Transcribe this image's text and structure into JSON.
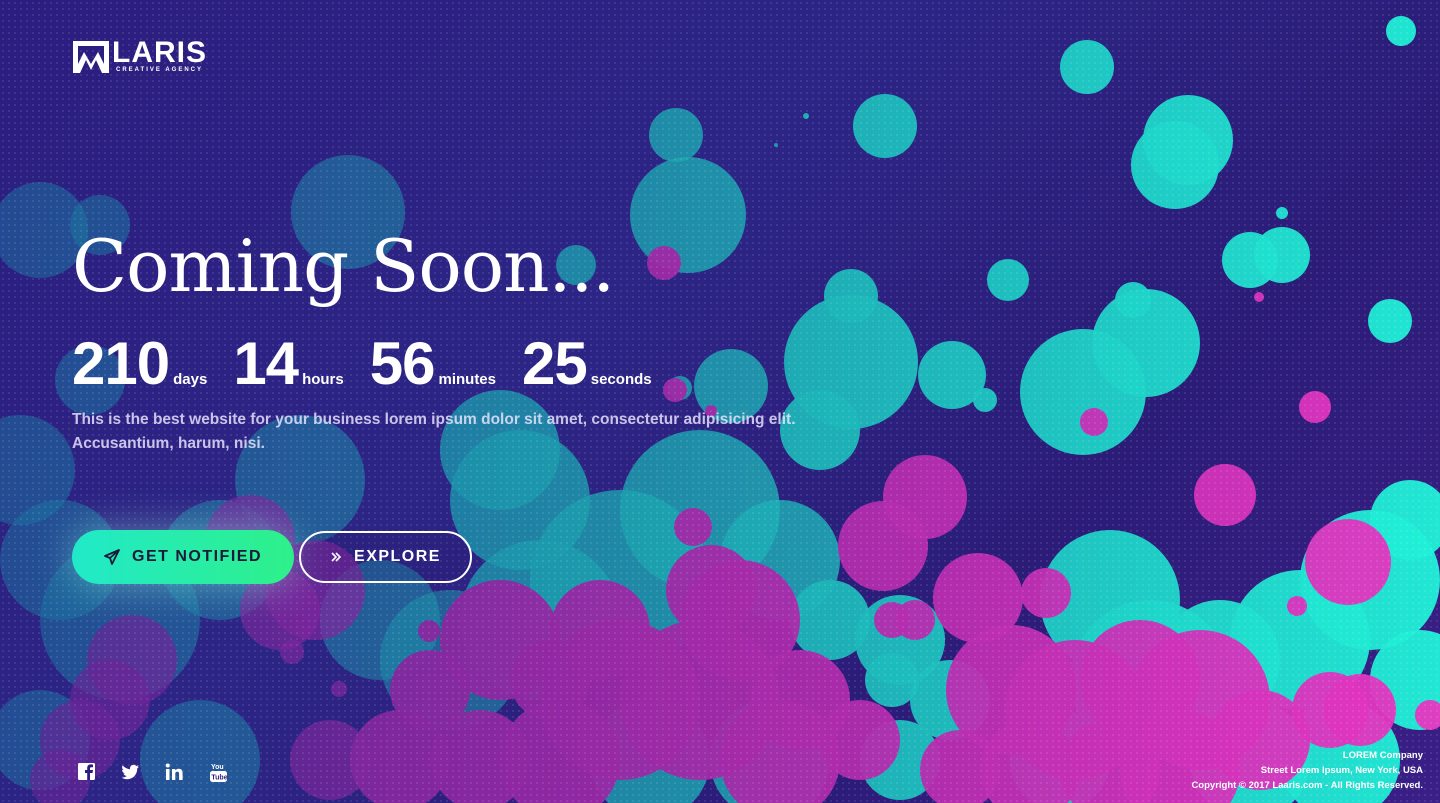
{
  "brand": {
    "name": "LARIS",
    "tagline": "CREATIVE AGENCY"
  },
  "hero": {
    "title": "Coming Soon..."
  },
  "countdown": {
    "days": {
      "value": "210",
      "label": "days"
    },
    "hours": {
      "value": "14",
      "label": "hours"
    },
    "minutes": {
      "value": "56",
      "label": "minutes"
    },
    "seconds": {
      "value": "25",
      "label": "seconds"
    }
  },
  "description": {
    "line1": "This is the best website for your business lorem ipsum dolor sit amet, consectetur adipisicing elit.",
    "line2": "Accusantium, harum, nisi."
  },
  "buttons": {
    "notify": {
      "label": "GET NOTIFIED",
      "icon": "paper-plane-icon"
    },
    "explore": {
      "label": "EXPLORE",
      "icon": "double-chevron-right-icon"
    }
  },
  "social": [
    {
      "name": "facebook-icon"
    },
    {
      "name": "twitter-icon"
    },
    {
      "name": "linkedin-icon"
    },
    {
      "name": "youtube-icon"
    }
  ],
  "footer": {
    "company": "LOREM Company",
    "address": "Street Lorem Ipsum, New York, USA",
    "copyright": "Copyright © 2017 Laaris.com - All Rights Reserved."
  },
  "colors": {
    "background": "#2b1d7f",
    "teal": "#1fd6c2",
    "magenta": "#d02eb5",
    "notify_gradient": [
      "#21e9c9",
      "#2ef08a"
    ]
  }
}
